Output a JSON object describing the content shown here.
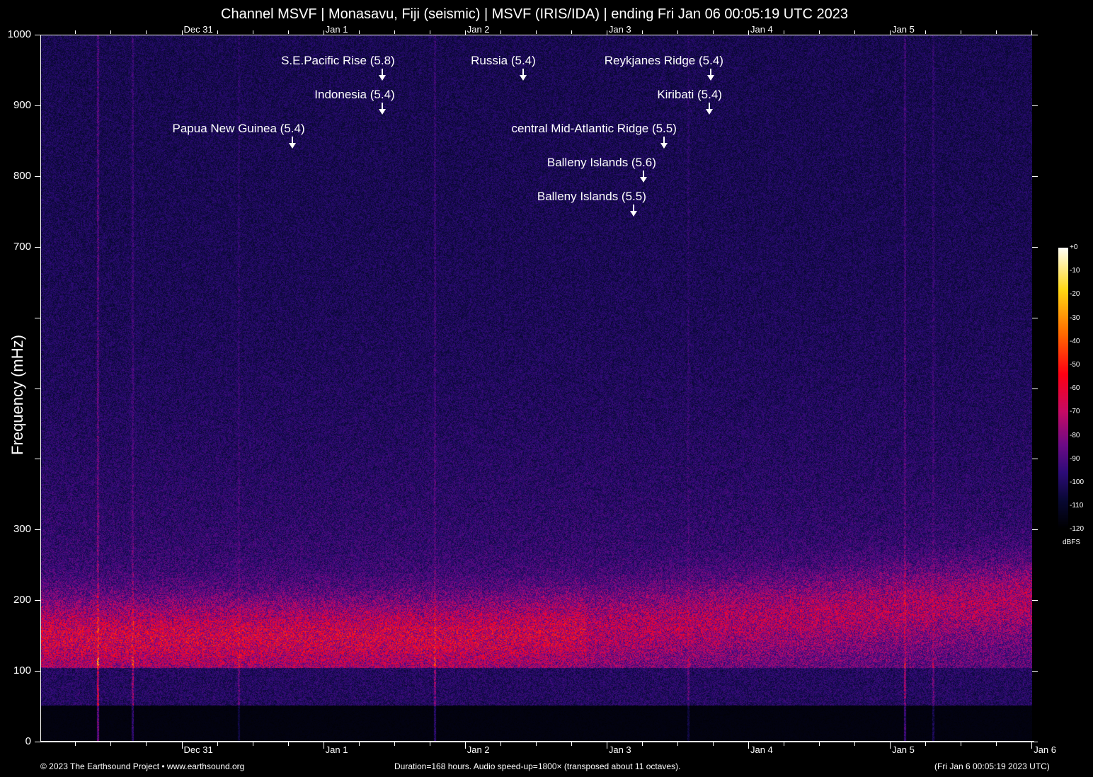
{
  "title": "Channel MSVF | Monasavu, Fiji (seismic) | MSVF (IRIS/IDA) | ending Fri Jan 06 00:05:19 UTC 2023",
  "footer": {
    "copyright": "© 2023 The Earthsound Project • www.earthsound.org",
    "info": "Duration=168 hours. Audio speed-up=1800× (transposed about 11 octaves).",
    "end_time": "(Fri Jan  6 00:05:19 2023 UTC)"
  },
  "chart_data": {
    "type": "heatmap",
    "title": "Channel MSVF | Monasavu, Fiji (seismic) | MSVF (IRIS/IDA) | ending Fri Jan 06 00:05:19 UTC 2023",
    "ylabel": "Frequency (mHz)",
    "xlabel": "",
    "ylim": [
      0,
      1000
    ],
    "y_ticks": [
      0,
      100,
      200,
      300,
      400,
      500,
      600,
      700,
      800,
      900,
      1000
    ],
    "y_tick_labels": [
      "0",
      "100",
      "200",
      "300",
      "",
      "",
      "",
      "700",
      "800",
      "900",
      "1000"
    ],
    "x_range_days_from_dec31": [
      -0.997,
      6.004
    ],
    "x_ticks_top": [
      "Dec 31",
      "Jan 1",
      "Jan 2",
      "Jan 3",
      "Jan 4",
      "Jan 5"
    ],
    "x_ticks_bottom": [
      "Dec 31",
      "Jan 1",
      "Jan 2",
      "Jan 3",
      "Jan 4",
      "Jan 5",
      "Jan 6"
    ],
    "colorbar": {
      "unit": "dBFS",
      "range": [
        -120,
        0
      ],
      "tick_labels": [
        "+0",
        "-10",
        "-20",
        "-30",
        "-40",
        "-50",
        "-60",
        "-70",
        "-80",
        "-90",
        "-100",
        "-110",
        "-120"
      ]
    },
    "spectral_features": {
      "main_band_mHz": [
        110,
        300
      ],
      "peak_band_mHz": 150,
      "peak_level_dBFS": -70,
      "background_level_dBFS": -115
    },
    "events": [
      {
        "label": "S.E.Pacific Rise (5.8)",
        "time_days": 1.415
      },
      {
        "label": "Russia (5.4)",
        "time_days": 2.41
      },
      {
        "label": "Reykjanes Ridge (5.4)",
        "time_days": 3.735
      },
      {
        "label": "Indonesia (5.4)",
        "time_days": 1.415
      },
      {
        "label": "Kiribati (5.4)",
        "time_days": 3.725
      },
      {
        "label": "Papua New Guinea (5.4)",
        "time_days": 0.78
      },
      {
        "label": "central Mid-Atlantic Ridge (5.5)",
        "time_days": 3.405
      },
      {
        "label": "Balleny Islands (5.6)",
        "time_days": 3.26
      },
      {
        "label": "Balleny Islands (5.5)",
        "time_days": 3.19
      }
    ]
  }
}
